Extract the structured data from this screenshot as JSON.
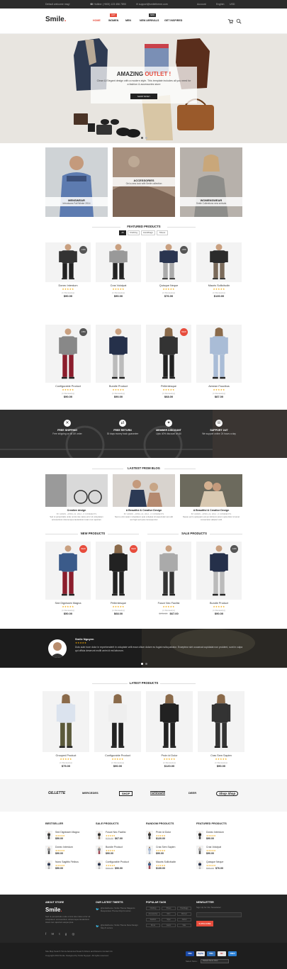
{
  "topbar": {
    "welcome": "Default welcome msg!",
    "phone": "Hotline: (+800) 123 456 7890",
    "email": "support@smiletheme.com",
    "account": "Account",
    "language": "English",
    "currency": "USD"
  },
  "header": {
    "logo": "Smile",
    "nav": [
      "HOME",
      "WOMEN",
      "MEN",
      "NEW ARRIVALS",
      "GET INSPIRED"
    ],
    "nav_badges": {
      "women": "HOT",
      "new_arrivals": "NEW"
    }
  },
  "hero": {
    "title_main": "AMAZING",
    "title_accent": "OUTLET !",
    "text": "Clean & Elegant design with a modern style. This template includes all you need for a fashion & accessories store",
    "button": "SHOP NOW !"
  },
  "categories": [
    {
      "title": "MENSWEAR",
      "subtitle": "Introduces Fall Winter 2014"
    },
    {
      "title": "ACCESSORIES",
      "subtitle": "Get a new look with Smile collection"
    },
    {
      "title": "WOMENSWEAR",
      "subtitle": "Smile Collections new arrivals"
    }
  ],
  "featured": {
    "title": "FEATURED PRODUCTS",
    "tabs": [
      "All",
      "Clothing",
      "Handbags",
      "Shoes"
    ],
    "products": [
      {
        "name": "Donec Interdum",
        "reviews": "(1 Review(s))",
        "price": "$90.00",
        "old": "",
        "badge": "-10%"
      },
      {
        "name": "Cras Volutpat",
        "reviews": "(1 Review(s))",
        "price": "$90.00",
        "old": "",
        "badge": ""
      },
      {
        "name": "Quisque Neque",
        "reviews": "(1 Review(s))",
        "price": "$76.00",
        "old": "",
        "badge": "-20%"
      },
      {
        "name": "Mauris Sollicitudin",
        "reviews": "(1 Review(s))",
        "price": "$130.00",
        "old": "",
        "badge": ""
      },
      {
        "name": "Configurable Product",
        "reviews": "(1 Review(s))",
        "price": "$90.00",
        "old": "",
        "badge": "-15%"
      },
      {
        "name": "Bundle Product",
        "reviews": "(1 Review(s))",
        "price": "$90.00",
        "old": "",
        "badge": ""
      },
      {
        "name": "Pellentesque",
        "reviews": "(1 Review(s))",
        "price": "$68.00",
        "old": "",
        "badge": "NEW"
      },
      {
        "name": "Aenean Faucibus",
        "reviews": "(1 Review(s))",
        "price": "$87.00",
        "old": "",
        "badge": ""
      }
    ]
  },
  "services": [
    {
      "title": "FREE SHIPPING",
      "text": "Free shipping on all UK order"
    },
    {
      "title": "FREE RETURN",
      "text": "30 days money back guarantee"
    },
    {
      "title": "MEMBER DISCOUNT",
      "text": "Upto 40% discount on All"
    },
    {
      "title": "SUPPORT 24/7",
      "text": "We support online 24 hours a day"
    }
  ],
  "blog": {
    "title": "LASTEST FROM BLOG",
    "posts": [
      {
        "title": "Creative design",
        "meta": "BY ADMIN - APRIL 22, 2014 - 0 COMMENTS",
        "text": "Sed ut perspiciatis unde omnis iste natus error sit voluptatem accusantium doloremque laudantium totam rem aperiam"
      },
      {
        "title": "A Beautiful & Creative Design",
        "meta": "BY ADMIN - APRIL 22, 2014 - 0 COMMENTS",
        "text": "Nemo enim ipsam voluptatem quia voluptas sit aspernatur aut odit aut fugit sed quia consequuntur"
      },
      {
        "title": "A Beautiful & Creative Design",
        "meta": "BY ADMIN - APRIL 22, 2014 - 0 COMMENTS",
        "text": "Neque porro quisquam est qui dolorem ipsum quia dolor sit amet consectetur adipisci velit"
      }
    ]
  },
  "new_products": {
    "title": "NEW PRODUCTS"
  },
  "sale_products": {
    "title": "SALE PRODUCTS"
  },
  "row3": [
    {
      "name": "Sed Dignissim Magna",
      "reviews": "(1 Review(s))",
      "price": "$50.00",
      "old": "",
      "badge": "NEW"
    },
    {
      "name": "Pellentesque",
      "reviews": "(1 Review(s))",
      "price": "$68.00",
      "old": "",
      "badge": "NEW"
    },
    {
      "name": "Fusce Nec Facilisi",
      "reviews": "(1 Review(s))",
      "price": "$67.00",
      "old": "$75.00",
      "badge": ""
    },
    {
      "name": "Bundle Product",
      "reviews": "(1 Review(s))",
      "price": "$90.00",
      "old": "",
      "badge": "-10%"
    }
  ],
  "testimonial": {
    "name": "Smile Nguyen",
    "text": "Duis aute irure dolor in reprehenderit in voluptate velit esse cillum dolore eu fugiat nulla pariatur. Excepteur sint occaecat cupidatat non proident, sunt in culpa qui officia deserunt mollit anim id est laborum."
  },
  "latest": {
    "title": "LATEST PRODUCTS",
    "products": [
      {
        "name": "Grouped Product",
        "reviews": "(1 Review(s))",
        "price": "$75.00"
      },
      {
        "name": "Configurable Product",
        "reviews": "(1 Review(s))",
        "price": "$90.00"
      },
      {
        "name": "Proin id Dolor",
        "reviews": "(1 Review(s))",
        "price": "$120.00"
      },
      {
        "name": "Cras Sem Sapien",
        "reviews": "(1 Review(s))",
        "price": "$90.00"
      }
    ]
  },
  "brands": [
    "GILLETTE",
    "MERCEDES",
    "SHOP",
    "HARDWARE",
    "DEER",
    "Shop Shop"
  ],
  "lists": [
    {
      "title": "BESTSELLER",
      "items": [
        {
          "name": "Sed Dignissim Magna",
          "price": "$50.00",
          "old": ""
        },
        {
          "name": "Donec Interdum",
          "price": "$90.00",
          "old": ""
        },
        {
          "name": "Nunc Sagittis Finibus",
          "price": "$50.00",
          "old": ""
        }
      ]
    },
    {
      "title": "SALE PRODUCTS",
      "items": [
        {
          "name": "Fusce Nec Facilisi",
          "price": "$67.00",
          "old": "$75.00"
        },
        {
          "name": "Bundle Product",
          "price": "$90.00",
          "old": ""
        },
        {
          "name": "Configurable Product",
          "price": "$90.00",
          "old": "$99.00"
        }
      ]
    },
    {
      "title": "RANDOM PRODUCTS",
      "items": [
        {
          "name": "Proin id Dolor",
          "price": "$120.00",
          "old": ""
        },
        {
          "name": "Cras Sem Sapien",
          "price": "$90.00",
          "old": ""
        },
        {
          "name": "Mauris Sollicitudin",
          "price": "$130.00",
          "old": ""
        }
      ]
    },
    {
      "title": "FEATURED PRODUCTS",
      "items": [
        {
          "name": "Donec Interdum",
          "price": "$90.00",
          "old": ""
        },
        {
          "name": "Cras Volutpat",
          "price": "$90.00",
          "old": ""
        },
        {
          "name": "Quisque Neque",
          "price": "$76.00",
          "old": "$95.00"
        }
      ]
    }
  ],
  "footer": {
    "about_title": "ABOUT STORE",
    "about_logo": "Smile",
    "about_text": "Sed ut perspiciatis unde omnis iste natus error sit voluptatem accusantium doloremque laudantium totam rem aperiam eaque ipsa.",
    "tweets_title": "OUR LATEST TWEETS",
    "tweets": [
      "@smiletheme: Smile Theme Magento Responsive Theme http://t.co/xxx",
      "@smiletheme: Smile Theme New Design http://t.co/xxx"
    ],
    "tags_title": "POPULAR TAGS",
    "tags": [
      "Clothing",
      "Shoes",
      "Handbags",
      "Accessories",
      "Men",
      "Women",
      "Fashion",
      "Style",
      "Jacket",
      "Dress",
      "Jeans",
      "Sale"
    ],
    "newsletter_title": "NEWSLETTER",
    "newsletter_text": "Sign Up for Our Newsletter:",
    "newsletter_placeholder": "",
    "subscribe": "SUBSCRIBE",
    "bottom_links": "Site Map  Search Terms  Advanced Search  Orders and Returns  Contact Us",
    "copyright": "Copyright 2014 Smile. Designed by Smile Nguyen. All rights reserved.",
    "payments": [
      "VISA",
      "PayPal",
      "VISA",
      "MC",
      "AMEX"
    ],
    "select_store": "Select Store:",
    "store_value": "Default Store View"
  },
  "colors": {
    "accent": "#e74c3c",
    "dark": "#222222",
    "footer": "#262626"
  }
}
